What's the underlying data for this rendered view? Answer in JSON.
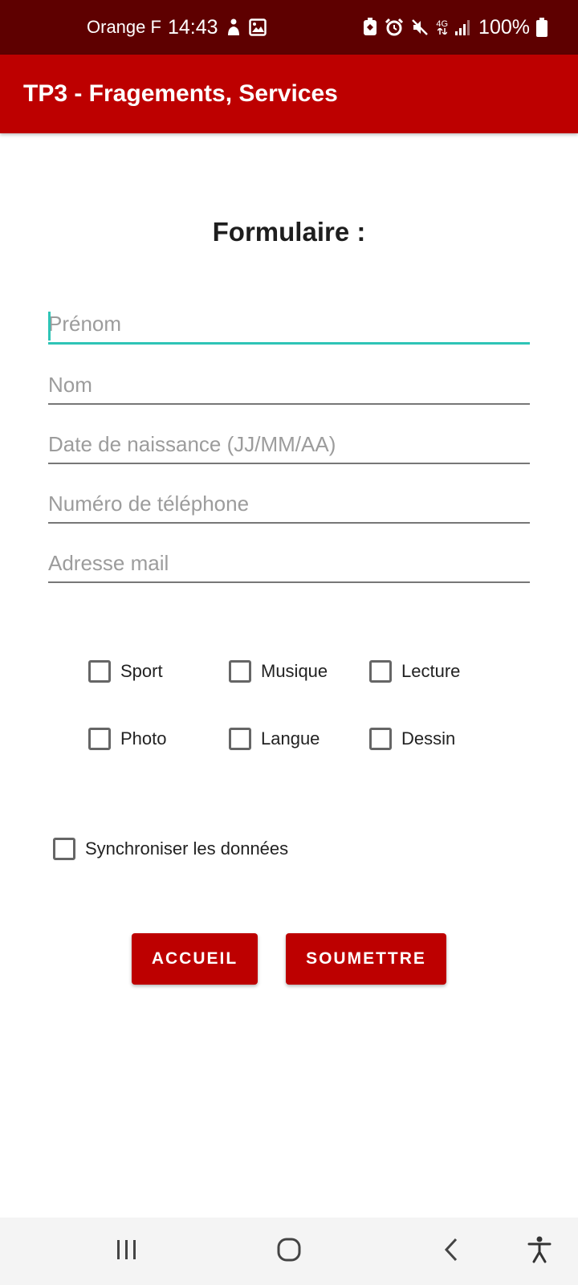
{
  "status_bar": {
    "carrier": "Orange F",
    "time": "14:43",
    "network": "4G",
    "battery": "100%"
  },
  "app_bar": {
    "title": "TP3 - Fragements, Services"
  },
  "form": {
    "title": "Formulaire :",
    "fields": [
      {
        "placeholder": "Prénom",
        "value": ""
      },
      {
        "placeholder": "Nom",
        "value": ""
      },
      {
        "placeholder": "Date de naissance (JJ/MM/AA)",
        "value": ""
      },
      {
        "placeholder": "Numéro de téléphone",
        "value": ""
      },
      {
        "placeholder": "Adresse mail",
        "value": ""
      }
    ],
    "hobbies": [
      {
        "label": "Sport",
        "checked": false
      },
      {
        "label": "Musique",
        "checked": false
      },
      {
        "label": "Lecture",
        "checked": false
      },
      {
        "label": "Photo",
        "checked": false
      },
      {
        "label": "Langue",
        "checked": false
      },
      {
        "label": "Dessin",
        "checked": false
      }
    ],
    "sync": {
      "label": "Synchroniser les données",
      "checked": false
    },
    "buttons": {
      "home": "ACCUEIL",
      "submit": "SOUMETTRE"
    }
  },
  "colors": {
    "status_bar": "#5e0000",
    "app_bar": "#bd0000",
    "accent": "#2ec4b6",
    "button": "#bd0000"
  },
  "icons": {
    "status_left": [
      "gesture-icon",
      "image-icon"
    ],
    "status_right": [
      "recycle-icon",
      "alarm-icon",
      "mute-icon",
      "signal-icon",
      "battery-icon"
    ],
    "navigation": [
      "recents-icon",
      "home-icon",
      "back-icon",
      "accessibility-icon"
    ]
  }
}
